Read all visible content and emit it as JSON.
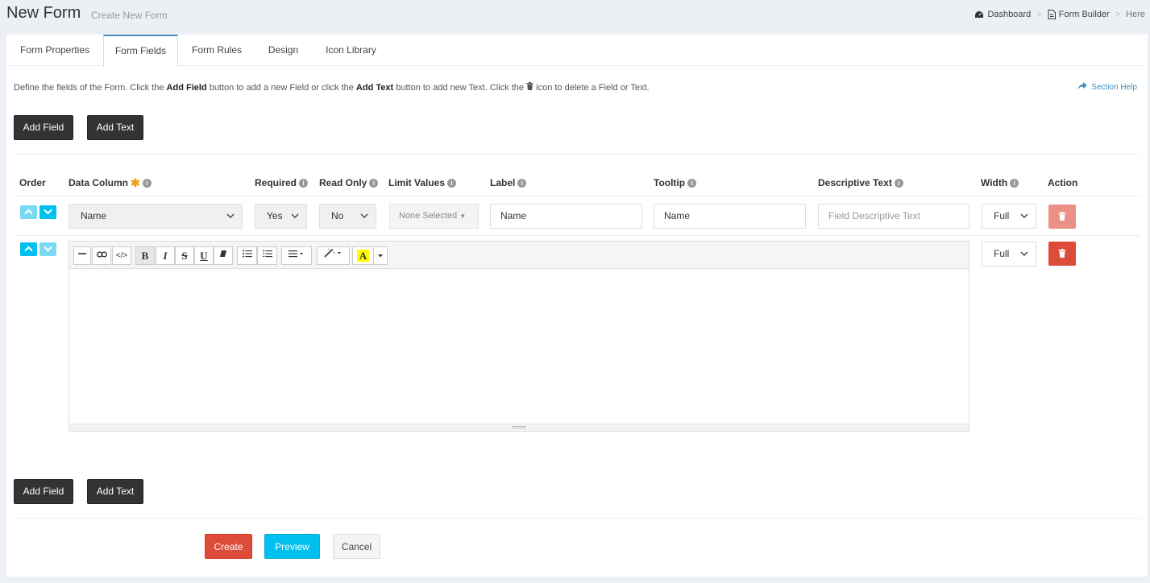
{
  "header": {
    "title": "New Form",
    "subtitle": "Create New Form",
    "breadcrumb": {
      "dashboard": "Dashboard",
      "separator": ">",
      "form_builder": "Form Builder",
      "here": "Here"
    }
  },
  "tabs": [
    {
      "label": "Form Properties"
    },
    {
      "label": "Form Fields",
      "active": true
    },
    {
      "label": "Form Rules"
    },
    {
      "label": "Design"
    },
    {
      "label": "Icon Library"
    }
  ],
  "instructions": {
    "part1": "Define the fields of the Form. Click the ",
    "add_field": "Add Field",
    "part2": " button to add a new Field or click the ",
    "add_text": "Add Text",
    "part3": " button to add new Text. Click the ",
    "part4": " icon to delete a Field or Text."
  },
  "section_help": "Section Help",
  "buttons": {
    "add_field": "Add Field",
    "add_text": "Add Text",
    "create": "Create",
    "preview": "Preview",
    "cancel": "Cancel"
  },
  "columns": {
    "order": "Order",
    "data_column": "Data Column",
    "required": "Required",
    "read_only": "Read Only",
    "limit_values": "Limit Values",
    "label": "Label",
    "tooltip": "Tooltip",
    "descriptive_text": "Descriptive Text",
    "width": "Width",
    "action": "Action"
  },
  "field_row": {
    "data_column": "Name",
    "required": "Yes",
    "read_only": "No",
    "limit_values": "None Selected",
    "label": "Name",
    "tooltip": "Name",
    "descriptive_text_placeholder": "Field Descriptive Text",
    "width": "Full"
  },
  "text_row": {
    "width": "Full"
  },
  "toolbar_icons": [
    "hr-icon",
    "link-icon",
    "code-view-icon",
    "bold-icon",
    "italic-icon",
    "strikethrough-icon",
    "underline-icon",
    "clear-format-icon",
    "unordered-list-icon",
    "ordered-list-icon",
    "align-icon",
    "style-magic-icon",
    "text-color-icon"
  ],
  "toolbar_labels": {
    "bold": "B",
    "italic": "I",
    "strike": "S",
    "underline": "U",
    "color": "A"
  },
  "colors": {
    "accent_blue": "#00c0ef",
    "danger_red": "#dd4b39",
    "dark_button": "#333333",
    "link_blue": "#3c8dbc",
    "star_orange": "#f39c12"
  }
}
